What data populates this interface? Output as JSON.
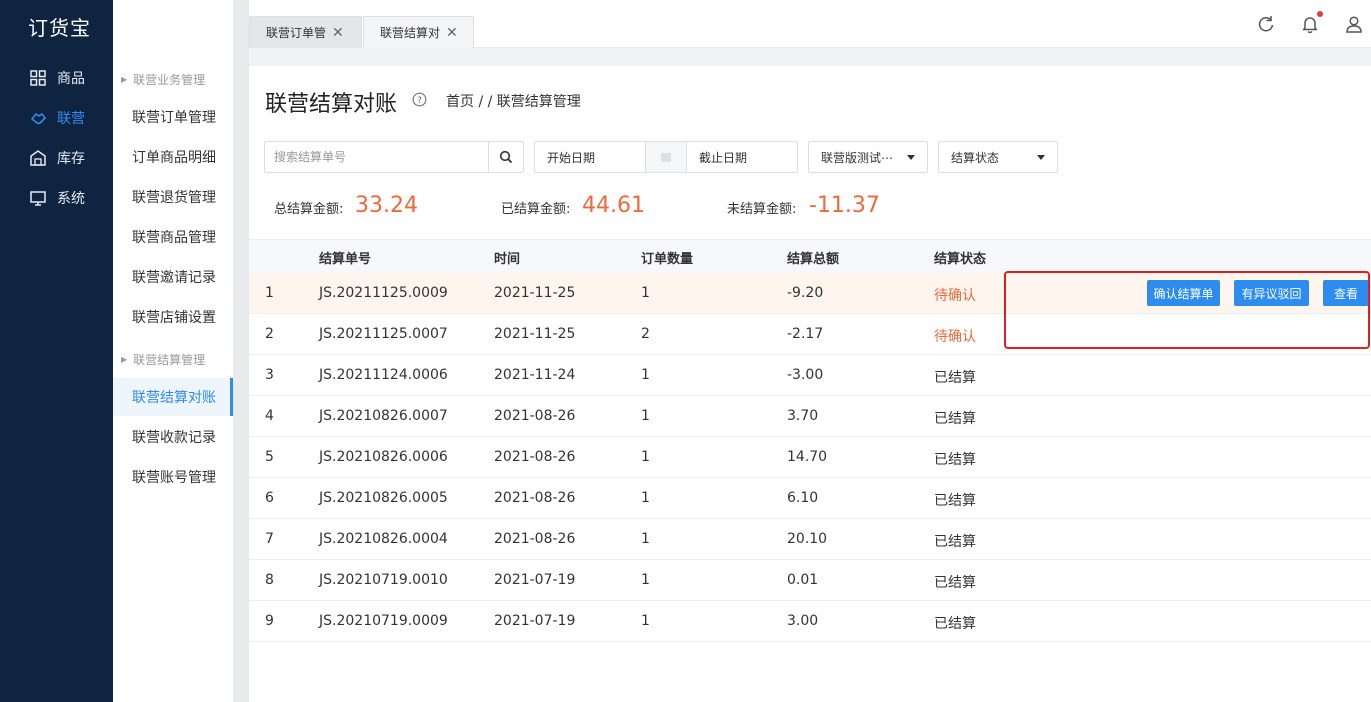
{
  "app": {
    "logo": "订货宝"
  },
  "nav": [
    {
      "label": "商品",
      "icon": "grid-icon"
    },
    {
      "label": "联营",
      "icon": "handshake-icon",
      "active": true
    },
    {
      "label": "库存",
      "icon": "warehouse-icon"
    },
    {
      "label": "系统",
      "icon": "monitor-icon"
    }
  ],
  "submenu": {
    "group1": "联营业务管理",
    "group2": "联营结算管理",
    "items1": [
      "联营订单管理",
      "订单商品明细",
      "联营退货管理",
      "联营商品管理",
      "联营邀请记录",
      "联营店铺设置"
    ],
    "items2": [
      "联营结算对账",
      "联营收款记录",
      "联营账号管理"
    ]
  },
  "tabs": [
    {
      "label": "联营订单管"
    },
    {
      "label": "联营结算对",
      "active": true
    }
  ],
  "page": {
    "title": "联营结算对账",
    "breadcrumb": "首页 / / 联营结算管理"
  },
  "filters": {
    "search_placeholder": "搜索结算单号",
    "start_date_placeholder": "开始日期",
    "end_date_placeholder": "截止日期",
    "store_select": "联营版测试⋯",
    "status_select": "结算状态"
  },
  "stats": {
    "total_label": "总结算金额:",
    "total_value": "33.24",
    "settled_label": "已结算金额:",
    "settled_value": "44.61",
    "unsettled_label": "未结算金额:",
    "unsettled_value": "-11.37"
  },
  "table": {
    "columns": [
      "结算单号",
      "时间",
      "订单数量",
      "结算总额",
      "结算状态"
    ],
    "rows": [
      {
        "idx": "1",
        "no": "JS.20211125.0009",
        "date": "2021-11-25",
        "count": "1",
        "amount": "-9.20",
        "status": "待确认",
        "pending": true
      },
      {
        "idx": "2",
        "no": "JS.20211125.0007",
        "date": "2021-11-25",
        "count": "2",
        "amount": "-2.17",
        "status": "待确认",
        "pending": true
      },
      {
        "idx": "3",
        "no": "JS.20211124.0006",
        "date": "2021-11-24",
        "count": "1",
        "amount": "-3.00",
        "status": "已结算"
      },
      {
        "idx": "4",
        "no": "JS.20210826.0007",
        "date": "2021-08-26",
        "count": "1",
        "amount": "3.70",
        "status": "已结算"
      },
      {
        "idx": "5",
        "no": "JS.20210826.0006",
        "date": "2021-08-26",
        "count": "1",
        "amount": "14.70",
        "status": "已结算"
      },
      {
        "idx": "6",
        "no": "JS.20210826.0005",
        "date": "2021-08-26",
        "count": "1",
        "amount": "6.10",
        "status": "已结算"
      },
      {
        "idx": "7",
        "no": "JS.20210826.0004",
        "date": "2021-08-26",
        "count": "1",
        "amount": "20.10",
        "status": "已结算"
      },
      {
        "idx": "8",
        "no": "JS.20210719.0010",
        "date": "2021-07-19",
        "count": "1",
        "amount": "0.01",
        "status": "已结算"
      },
      {
        "idx": "9",
        "no": "JS.20210719.0009",
        "date": "2021-07-19",
        "count": "1",
        "amount": "3.00",
        "status": "已结算"
      }
    ],
    "actions": {
      "confirm": "确认结算单",
      "dispute": "有异议驳回",
      "view": "查看"
    }
  },
  "colors": {
    "sidebar_bg": "#0f2440",
    "primary": "#2d8cf0",
    "accent_orange": "#f2683c",
    "highlight_row": "#fef5ee",
    "annotation_red": "#e02020"
  }
}
